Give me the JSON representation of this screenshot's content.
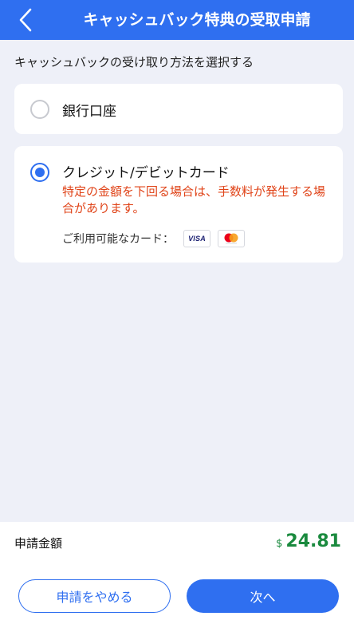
{
  "header": {
    "title": "キャッシュバック特典の受取申請",
    "back_icon": "chevron-left-icon"
  },
  "section": {
    "title": "キャッシュバックの受け取り方法を選択する"
  },
  "options": [
    {
      "label": "銀行口座",
      "selected": false
    },
    {
      "label": "クレジット/デビットカード",
      "selected": true,
      "warning": "特定の金額を下回る場合は、手数料が発生する場合があります。",
      "cards_label": "ご利用可能なカード：",
      "card_brands": [
        "visa-icon",
        "mastercard-icon"
      ]
    }
  ],
  "footer": {
    "amount_label": "申請金額",
    "currency": "$",
    "amount": "24.81",
    "cancel_label": "申請をやめる",
    "next_label": "次へ"
  },
  "colors": {
    "primary": "#2f6ff0",
    "warning": "#e04419",
    "amount": "#1a8a3e",
    "background": "#eef0f8"
  }
}
